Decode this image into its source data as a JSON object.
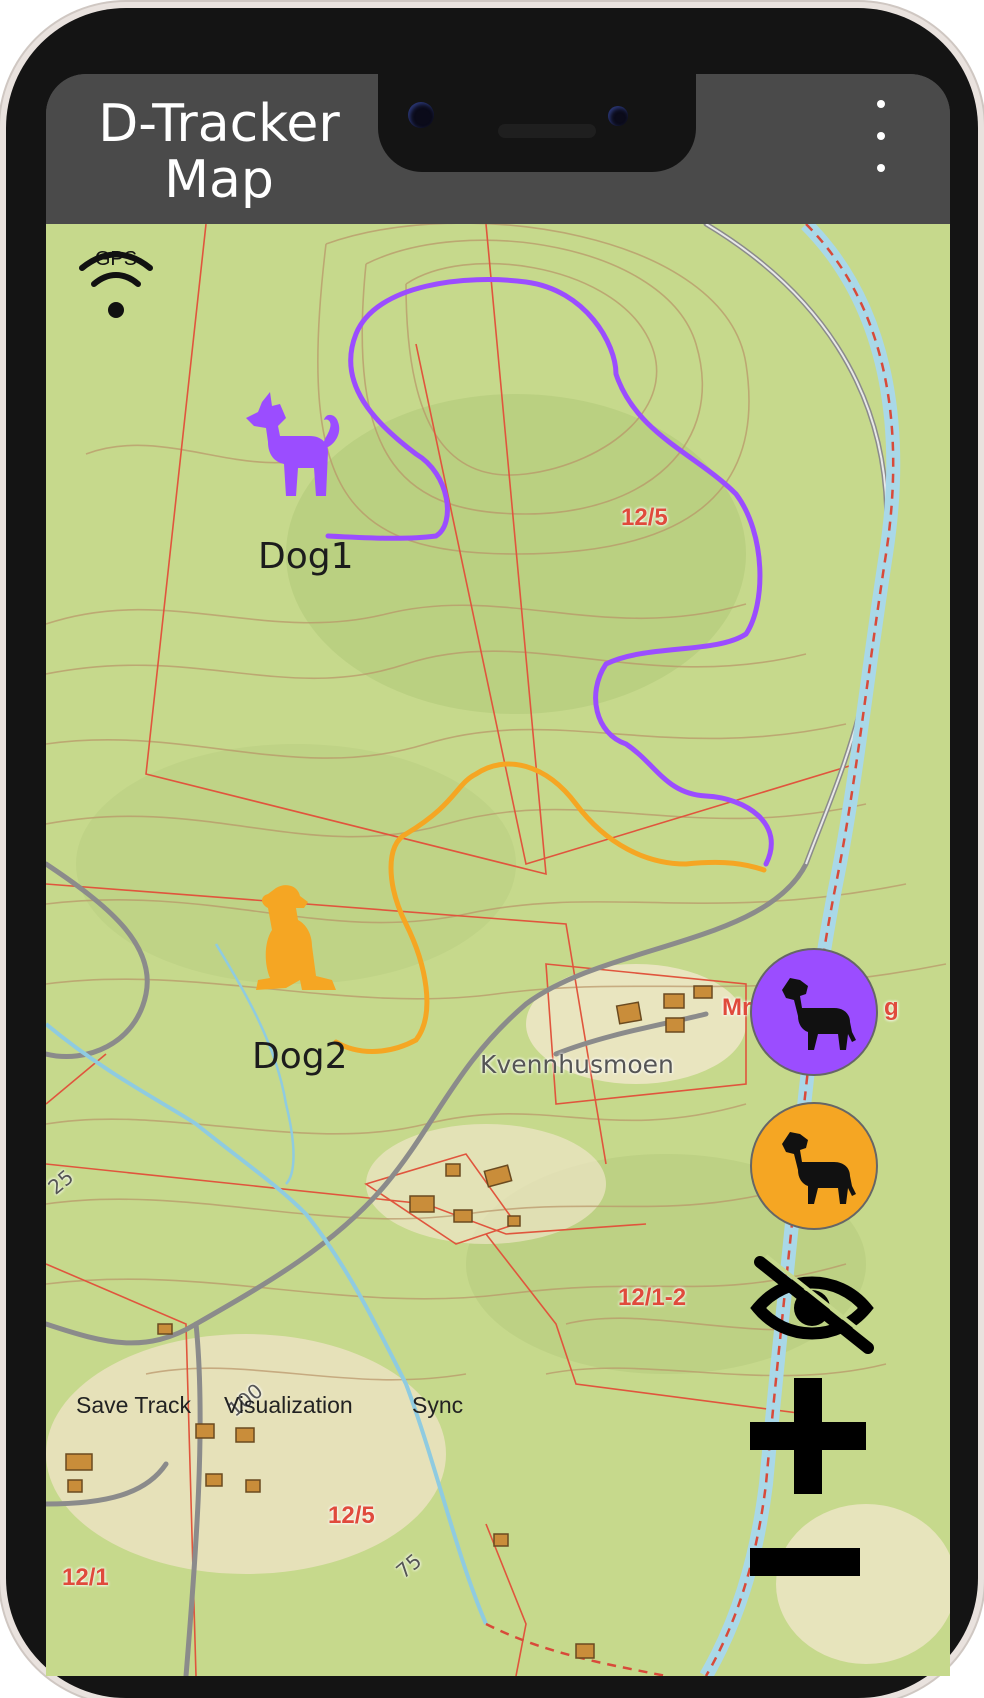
{
  "app": {
    "title_line1": "D-Tracker",
    "title_line2": "Map",
    "menu_icon": "more-vert-icon"
  },
  "gps": {
    "label": "GPS",
    "icon": "wifi-signal-icon"
  },
  "dogs": [
    {
      "name": "Dog1",
      "color": "#9b4dff",
      "icon": "standing-dog-icon"
    },
    {
      "name": "Dog2",
      "color": "#f5a623",
      "icon": "sitting-dog-icon"
    }
  ],
  "map_labels": {
    "parcel_a": "12/5",
    "parcel_b": "12/1-2",
    "parcel_c": "12/5",
    "parcel_d": "12/1",
    "place": "Kvennhusmoen",
    "partial": "Mr",
    "partial_right": "g",
    "contour_100": "100",
    "contour_75": "75",
    "contour_25": "25"
  },
  "controls": {
    "dog1_button_color": "#9b4dff",
    "dog2_button_color": "#f5a623",
    "hide_icon": "eye-off-icon",
    "zoom_in_icon": "plus-icon",
    "zoom_out_icon": "minus-icon"
  },
  "bottom_tabs": [
    "Save Track",
    "Visualization",
    "Sync"
  ]
}
